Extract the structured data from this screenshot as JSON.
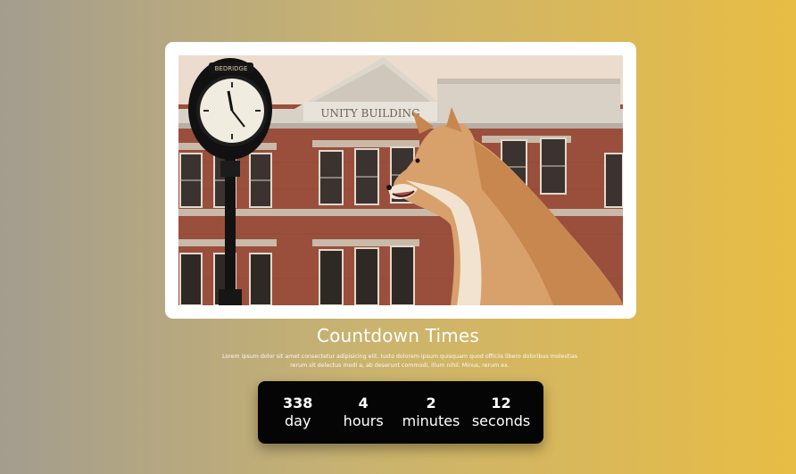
{
  "title": "Countdown Times",
  "description": "Lorem ipsum dolor sit amet consectetur adipisicing elit. Iusto dolorem ipsum quisquam quod officiis libero doloribus molestias rerum sit delectus modi a, ab deserunt commodi, illum nihil. Minus, rerum ex.",
  "photo": {
    "clock_sign": "BEDRIDGE",
    "building_sign": "UNITY BUILDING"
  },
  "countdown": {
    "units": [
      {
        "value": "338",
        "label": "day"
      },
      {
        "value": "4",
        "label": "hours"
      },
      {
        "value": "2",
        "label": "minutes"
      },
      {
        "value": "12",
        "label": "seconds"
      }
    ]
  },
  "colors": {
    "gradient_start": "#a39d8f",
    "gradient_end": "#e8bd45",
    "countdown_bg": "#050505",
    "text": "#ffffff"
  }
}
